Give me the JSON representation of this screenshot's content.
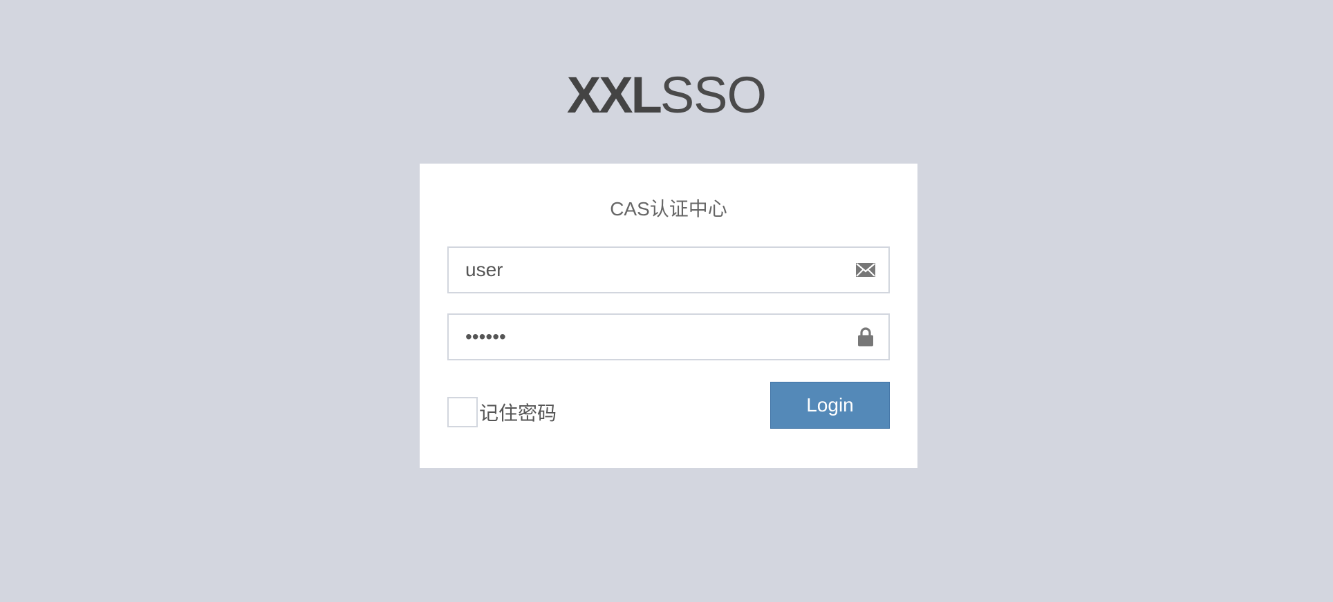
{
  "logo": {
    "bold": "XXL",
    "thin": "SSO"
  },
  "login_box": {
    "title": "CAS认证中心",
    "username": {
      "value": "user",
      "icon": "envelope-icon"
    },
    "password": {
      "value": "••••••",
      "icon": "lock-icon"
    },
    "remember_label": "记住密码",
    "remember_checked": false,
    "login_button": "Login"
  },
  "colors": {
    "background": "#d3d6df",
    "button": "#5489b8",
    "text": "#555555"
  }
}
